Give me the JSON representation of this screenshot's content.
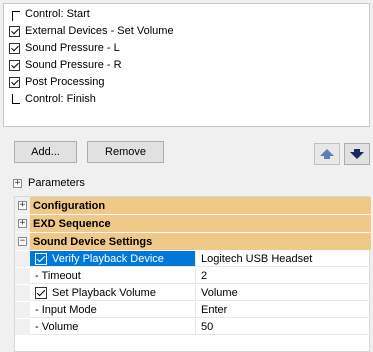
{
  "steps": [
    {
      "label": "Control: Start",
      "kind": "start"
    },
    {
      "label": "External Devices - Set Volume",
      "kind": "checkbox",
      "checked": true
    },
    {
      "label": "Sound Pressure - L",
      "kind": "checkbox",
      "checked": true
    },
    {
      "label": "Sound Pressure - R",
      "kind": "checkbox",
      "checked": true
    },
    {
      "label": "Post Processing",
      "kind": "checkbox",
      "checked": true
    },
    {
      "label": "Control: Finish",
      "kind": "finish"
    }
  ],
  "buttons": {
    "add_label": "Add...",
    "remove_label": "Remove"
  },
  "parameters": {
    "header_label": "Parameters",
    "expander_symbol": "+",
    "categories": [
      {
        "title": "Configuration",
        "expanded": false,
        "symbol": "+"
      },
      {
        "title": "EXD Sequence",
        "expanded": false,
        "symbol": "+"
      },
      {
        "title": "Sound Device Settings",
        "expanded": true,
        "symbol": "−"
      }
    ],
    "rows": [
      {
        "name": "Verify Playback Device",
        "value": "Logitech USB Headset",
        "checkbox": true,
        "checked": true,
        "selected": true
      },
      {
        "name": "- Timeout",
        "value": "2",
        "checkbox": false
      },
      {
        "name": "Set Playback Volume",
        "value": "Volume",
        "checkbox": true,
        "checked": true
      },
      {
        "name": "- Input Mode",
        "value": "Enter",
        "checkbox": false
      },
      {
        "name": "- Volume",
        "value": "50",
        "checkbox": false
      }
    ]
  },
  "colors": {
    "category_bg": "#f0c988",
    "selection": "#0078d7",
    "up_arrow": "#5a7fb0",
    "down_arrow": "#1a2a5a"
  }
}
